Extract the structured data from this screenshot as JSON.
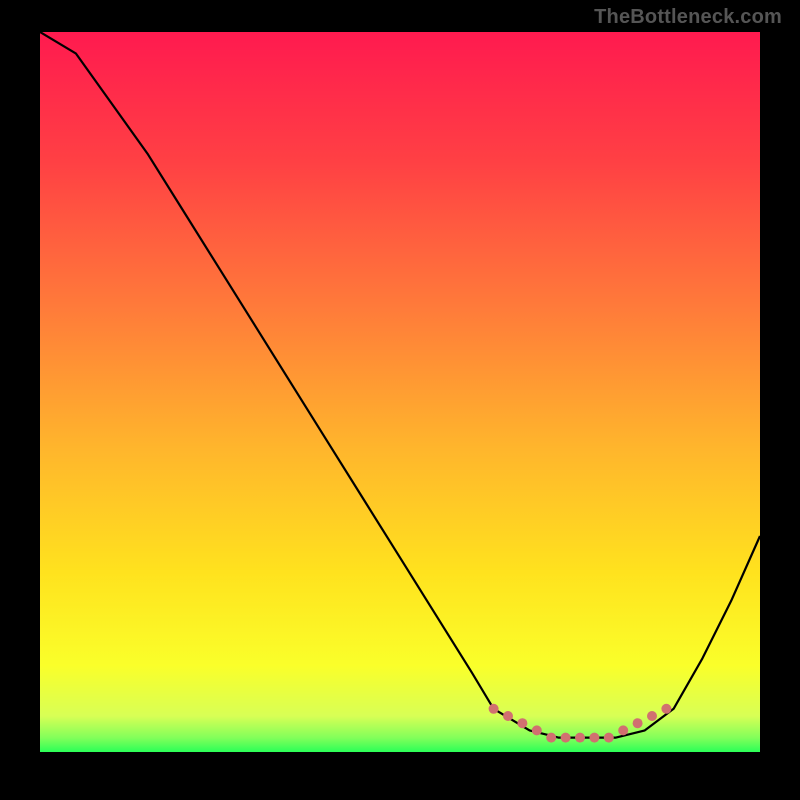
{
  "watermark": "TheBottleneck.com",
  "colors": {
    "background": "#000000",
    "curve": "#000000",
    "marker": "#d17070",
    "gradient_stops": [
      {
        "pct": 0,
        "hex": "#ff1a4f"
      },
      {
        "pct": 18,
        "hex": "#ff4044"
      },
      {
        "pct": 38,
        "hex": "#ff7a3a"
      },
      {
        "pct": 58,
        "hex": "#ffb62c"
      },
      {
        "pct": 75,
        "hex": "#ffe21e"
      },
      {
        "pct": 88,
        "hex": "#faff2a"
      },
      {
        "pct": 95,
        "hex": "#d8ff55"
      },
      {
        "pct": 98,
        "hex": "#83ff5a"
      },
      {
        "pct": 100,
        "hex": "#2bff58"
      }
    ]
  },
  "chart_data": {
    "type": "line",
    "title": "",
    "xlabel": "",
    "ylabel": "",
    "xlim": [
      0,
      100
    ],
    "ylim": [
      0,
      100
    ],
    "grid": false,
    "series": [
      {
        "name": "bottleneck-curve",
        "x": [
          0,
          5,
          10,
          15,
          20,
          25,
          30,
          35,
          40,
          45,
          50,
          55,
          60,
          63,
          68,
          72,
          76,
          80,
          84,
          88,
          92,
          96,
          100
        ],
        "values": [
          100,
          97,
          90,
          83,
          75,
          67,
          59,
          51,
          43,
          35,
          27,
          19,
          11,
          6,
          3,
          2,
          2,
          2,
          3,
          6,
          13,
          21,
          30
        ]
      }
    ],
    "markers": {
      "name": "highlighted-range",
      "x": [
        63,
        65,
        67,
        69,
        71,
        73,
        75,
        77,
        79,
        81,
        83,
        85,
        87
      ],
      "values": [
        6,
        5,
        4,
        3,
        2,
        2,
        2,
        2,
        2,
        3,
        4,
        5,
        6
      ],
      "style": {
        "shape": "circle",
        "size": 5,
        "fill": "#d17070"
      }
    }
  }
}
